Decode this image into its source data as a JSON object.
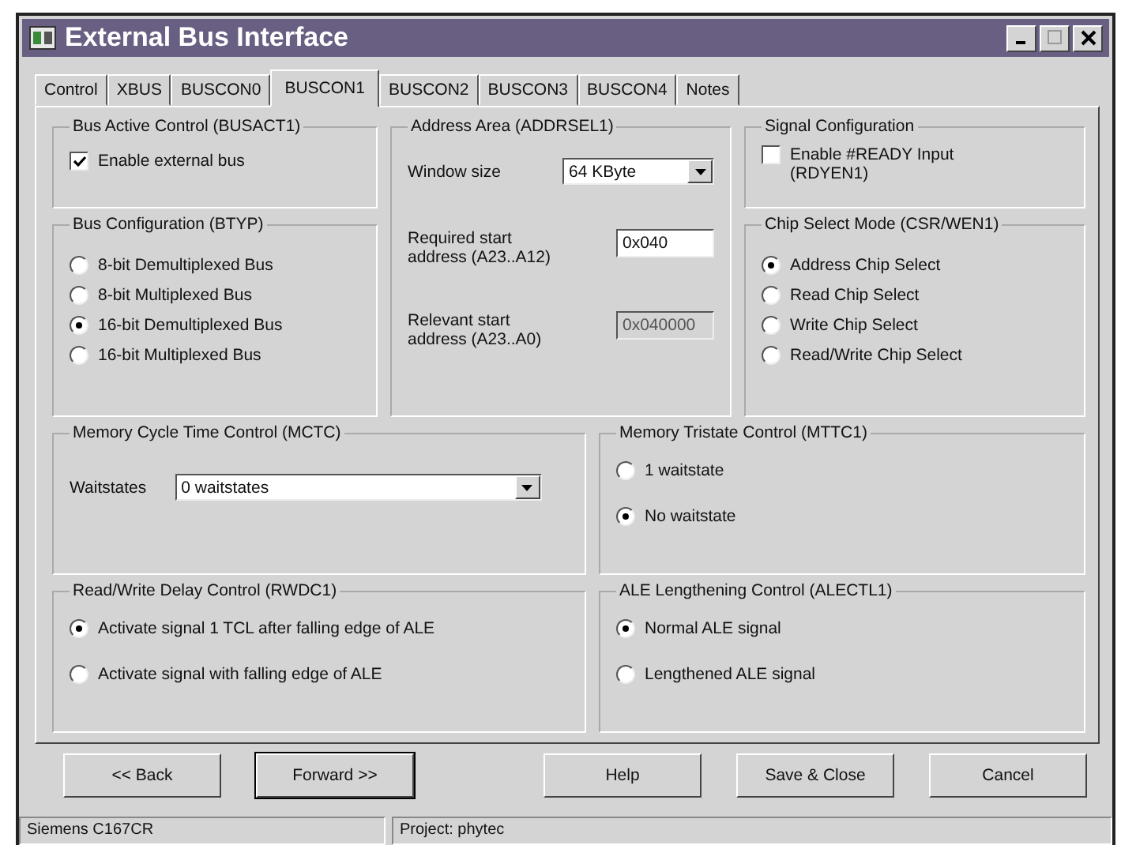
{
  "window": {
    "title": "External Bus Interface"
  },
  "tabs": [
    {
      "label": "Control",
      "selected": false
    },
    {
      "label": "XBUS",
      "selected": false
    },
    {
      "label": "BUSCON0",
      "selected": false
    },
    {
      "label": "BUSCON1",
      "selected": true
    },
    {
      "label": "BUSCON2",
      "selected": false
    },
    {
      "label": "BUSCON3",
      "selected": false
    },
    {
      "label": "BUSCON4",
      "selected": false
    },
    {
      "label": "Notes",
      "selected": false
    }
  ],
  "bus_active": {
    "title": "Bus Active Control (BUSACT1)",
    "controls": [
      {
        "kind": "checkbox",
        "label": "Enable external bus",
        "checked": true
      }
    ]
  },
  "bus_configuration": {
    "title": "Bus Configuration (BTYP)",
    "controls": [
      {
        "kind": "radio",
        "label": "8-bit Demultiplexed Bus",
        "selected": false
      },
      {
        "kind": "radio",
        "label": "8-bit Multiplexed Bus",
        "selected": false
      },
      {
        "kind": "radio",
        "label": "16-bit Demultiplexed Bus",
        "selected": true
      },
      {
        "kind": "radio",
        "label": "16-bit Multiplexed Bus",
        "selected": false
      }
    ]
  },
  "address_area": {
    "title": "Address Area (ADDRSEL1)",
    "controls": [
      {
        "kind": "dropdown",
        "label": "Window size",
        "value": "64 KByte"
      },
      {
        "kind": "field",
        "label": "Required start address (A23..A12)",
        "value": "0x040",
        "disabled": false
      },
      {
        "kind": "field",
        "label": "Relevant start address (A23..A0)",
        "value": "0x040000",
        "disabled": true
      }
    ]
  },
  "signal_configuration": {
    "title": "Signal Configuration",
    "controls": [
      {
        "kind": "checkbox",
        "label": "Enable #READY Input (RDYEN1)",
        "checked": false
      }
    ]
  },
  "chip_select_mode": {
    "title": "Chip Select Mode (CSR/WEN1)",
    "controls": [
      {
        "kind": "radio",
        "label": "Address Chip Select",
        "selected": true
      },
      {
        "kind": "radio",
        "label": "Read Chip Select",
        "selected": false
      },
      {
        "kind": "radio",
        "label": "Write Chip Select",
        "selected": false
      },
      {
        "kind": "radio",
        "label": "Read/Write Chip Select",
        "selected": false
      }
    ]
  },
  "memory_cycle": {
    "title": "Memory Cycle Time Control (MCTC)",
    "controls": [
      {
        "kind": "dropdown",
        "label": "Waitstates",
        "value": "0 waitstates"
      }
    ]
  },
  "memory_tristate": {
    "title": "Memory Tristate Control (MTTC1)",
    "controls": [
      {
        "kind": "radio",
        "label": "1 waitstate",
        "selected": false
      },
      {
        "kind": "radio",
        "label": "No waitstate",
        "selected": true
      }
    ]
  },
  "read_write_delay": {
    "title": "Read/Write Delay Control (RWDC1)",
    "controls": [
      {
        "kind": "radio",
        "label": "Activate signal 1 TCL after falling edge of ALE",
        "selected": true
      },
      {
        "kind": "radio",
        "label": "Activate signal with falling edge of ALE",
        "selected": false
      }
    ]
  },
  "ale_lengthening": {
    "title": "ALE Lengthening Control (ALECTL1)",
    "controls": [
      {
        "kind": "radio",
        "label": "Normal ALE signal",
        "selected": true
      },
      {
        "kind": "radio",
        "label": "Lengthened ALE signal",
        "selected": false
      }
    ]
  },
  "buttons": [
    {
      "label": "<< Back",
      "default": false
    },
    {
      "label": "Forward >>",
      "default": true
    },
    {
      "label": "Help",
      "default": false
    },
    {
      "label": "Save & Close",
      "default": false
    },
    {
      "label": "Cancel",
      "default": false
    }
  ],
  "status_bar": [
    "Siemens C167CR",
    "Project: phytec"
  ]
}
